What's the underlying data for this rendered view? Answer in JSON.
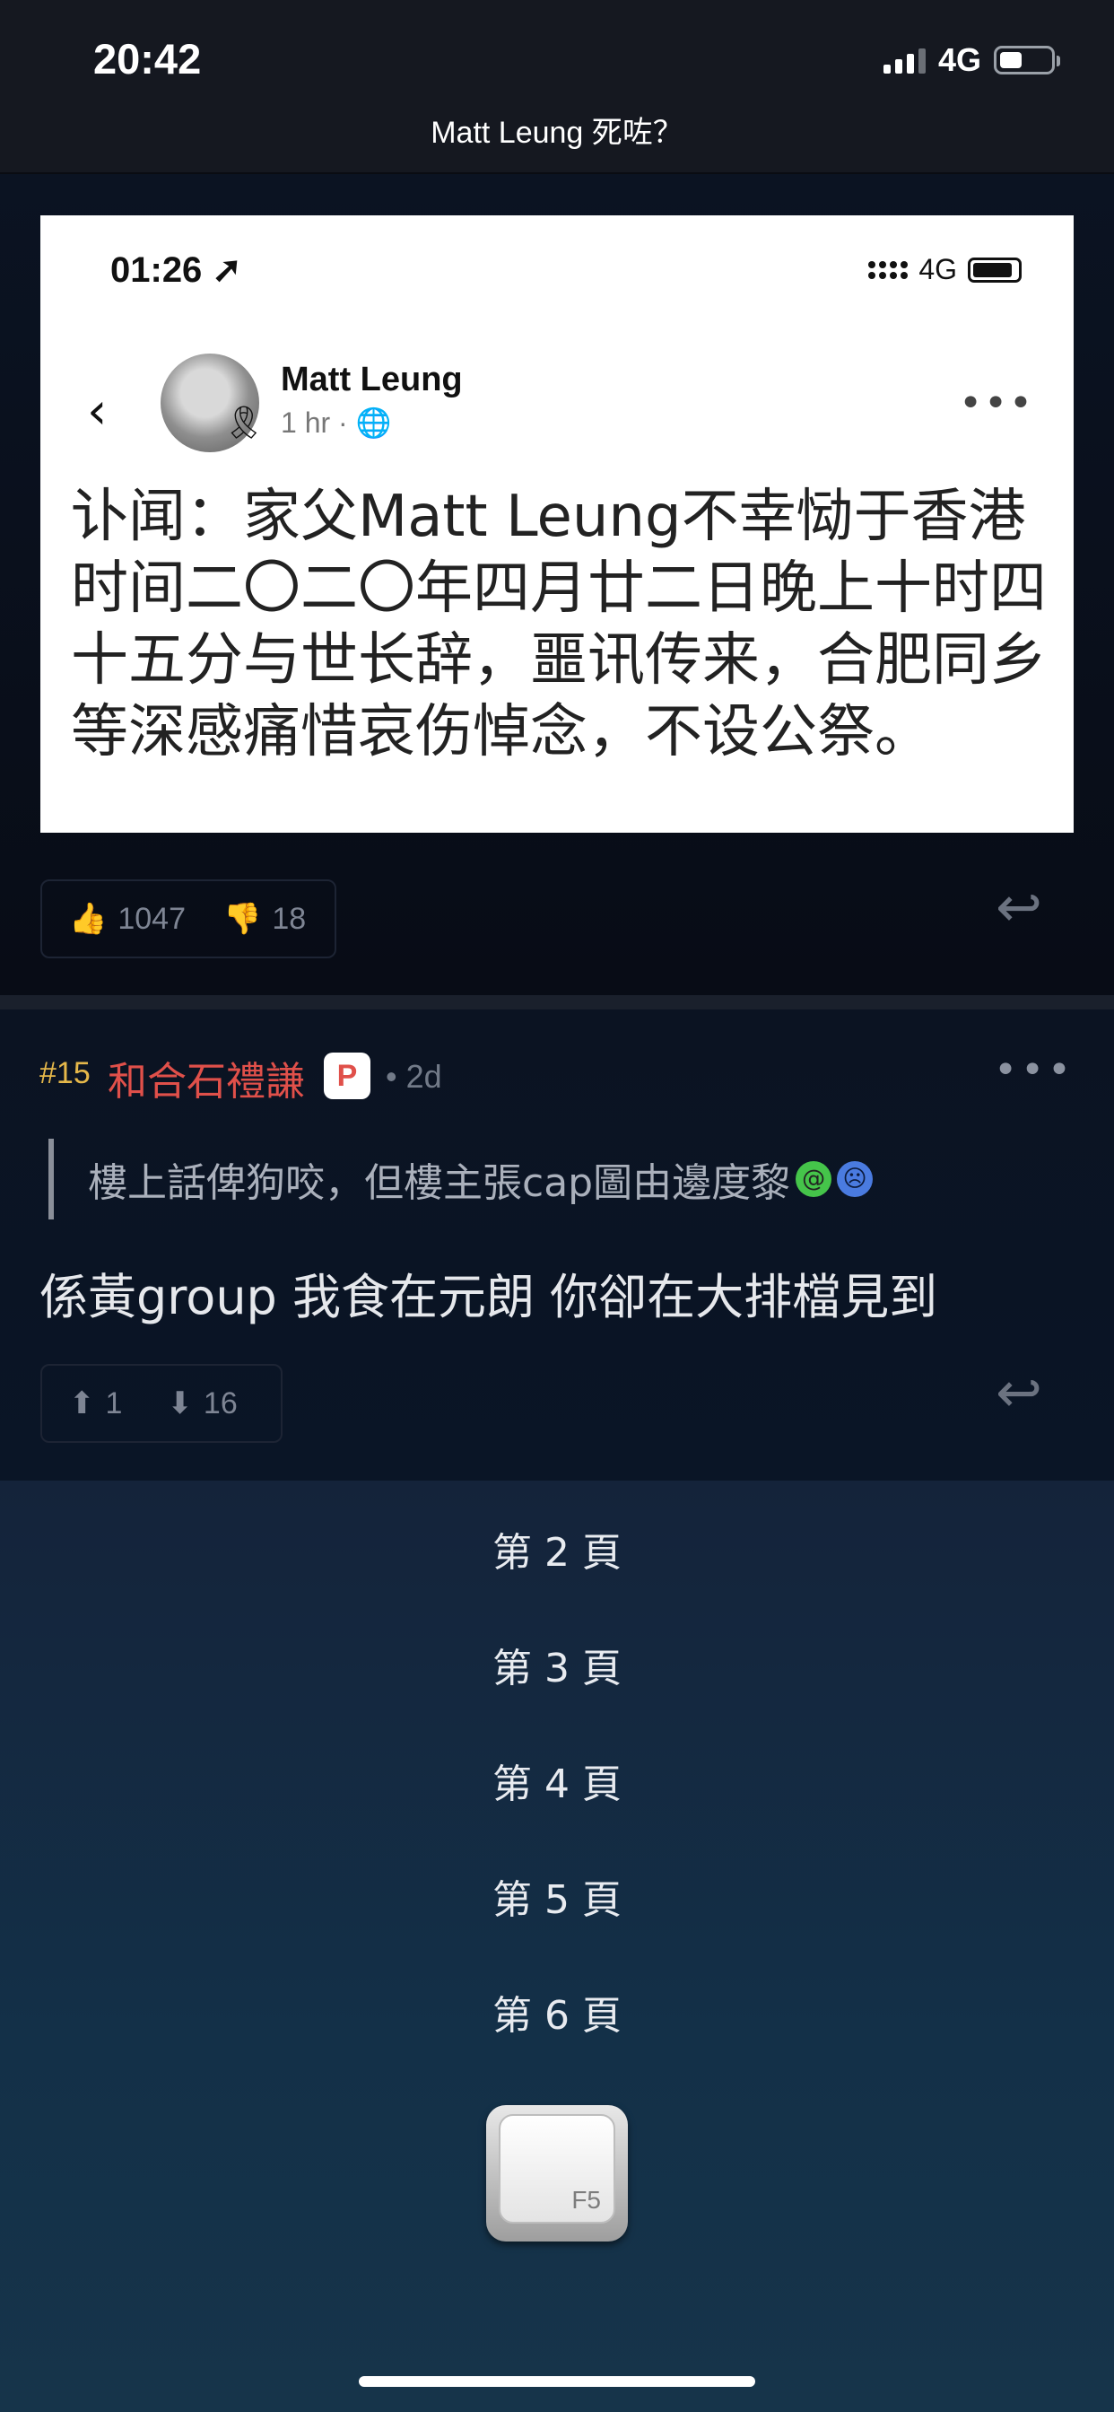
{
  "status_bar": {
    "time": "20:42",
    "network": "4G"
  },
  "header": {
    "title": "Matt Leung 死咗？"
  },
  "post1": {
    "embedded_screenshot": {
      "time": "01:26 ➚",
      "network": "4G",
      "author": "Matt Leung",
      "meta": "1 hr · 🌐",
      "text": "讣闻：家父Matt Leung不幸恸于香港时间二〇二〇年四月廿二日晚上十时四十五分与世长辞，噩讯传来，合肥同乡等深感痛惜哀伤悼念，不设公祭。"
    },
    "likes": "1047",
    "dislikes": "18"
  },
  "post2": {
    "number": "#15",
    "username": "和合石禮謙",
    "badge": "P",
    "time": "• 2d",
    "quote": "樓上話俾狗咬，但樓主張cap圖由邊度黎",
    "body": "係黃group 我食在元朗 你卻在大排檔見到",
    "upvotes": "1",
    "downvotes": "16"
  },
  "pagination": {
    "pages": [
      "第 2 頁",
      "第 3 頁",
      "第 4 頁",
      "第 5 頁",
      "第 6 頁"
    ],
    "refresh_key_label": "F5"
  },
  "colors": {
    "username": "#e0504a",
    "post_number": "#e6b84a",
    "background": "#0d1424"
  }
}
